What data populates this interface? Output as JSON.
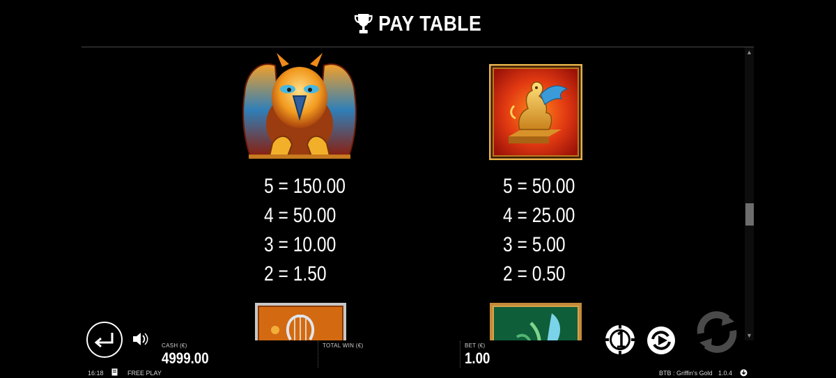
{
  "header": {
    "title": "PAY TABLE",
    "icon": "trophy-icon"
  },
  "symbols": [
    {
      "name": "griffin",
      "pays": [
        "5 = 150.00",
        "4 = 50.00",
        "3 = 10.00",
        "2 = 1.50"
      ]
    },
    {
      "name": "golden-griffin-statue",
      "pays": [
        "5 = 50.00",
        "4 = 25.00",
        "3 = 5.00",
        "2 = 0.50"
      ]
    },
    {
      "name": "lyre"
    },
    {
      "name": "feather"
    }
  ],
  "balance": {
    "cash_label": "CASH (€)",
    "cash_value": "4999.00",
    "total_win_label": "TOTAL WIN (€)",
    "total_win_value": "",
    "bet_label": "BET (€)",
    "bet_value": "1.00"
  },
  "footer": {
    "time": "16:18",
    "mode": "FREE PLAY",
    "game_name": "BTB : Griffin's Gold",
    "version": "1.0.4"
  },
  "colors": {
    "background": "#000000",
    "gold": "#e8a523",
    "red_tile": "#c81d10"
  }
}
